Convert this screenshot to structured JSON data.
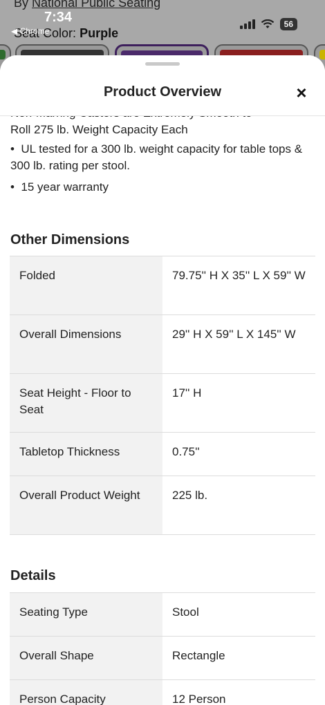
{
  "background": {
    "by_prefix": "By",
    "brand_link": "National Public Seating",
    "color_label": "Seat Color:",
    "color_value": "Purple"
  },
  "status_bar": {
    "time": "7:34",
    "back_label": "◀ Chrome",
    "battery": "56"
  },
  "sheet": {
    "title": "Product Overview",
    "close_label": "×"
  },
  "bullets": {
    "partial_line1": "Non-Marring Casters are Extremely Smooth to",
    "partial_line2": "Roll 275 lb. Weight Capacity Each",
    "items": [
      "UL tested for a 300 lb. weight capacity for table tops & 300 lb. rating per stool.",
      "15 year warranty"
    ]
  },
  "other_dimensions": {
    "title": "Other Dimensions",
    "rows": [
      {
        "label": "Folded",
        "value": "79.75'' H X 35'' L X 59'' W"
      },
      {
        "label": "Overall Dimensions",
        "value": "29'' H X 59'' L X 145'' W"
      },
      {
        "label": "Seat Height - Floor to Seat",
        "value": "17'' H"
      },
      {
        "label": "Tabletop Thickness",
        "value": "0.75''"
      },
      {
        "label": "Overall Product Weight",
        "value": "225 lb."
      }
    ]
  },
  "details": {
    "title": "Details",
    "rows": [
      {
        "label": "Seating Type",
        "value": "Stool"
      },
      {
        "label": "Overall Shape",
        "value": "Rectangle"
      },
      {
        "label": "Person Capacity",
        "value": "12 Person"
      }
    ]
  },
  "colors": {
    "swatch_green": "#2e6b2e",
    "swatch_dark": "#333333",
    "swatch_purple": "#4b2a6b",
    "swatch_red": "#8a1f1f",
    "swatch_yellow": "#c9b400"
  }
}
